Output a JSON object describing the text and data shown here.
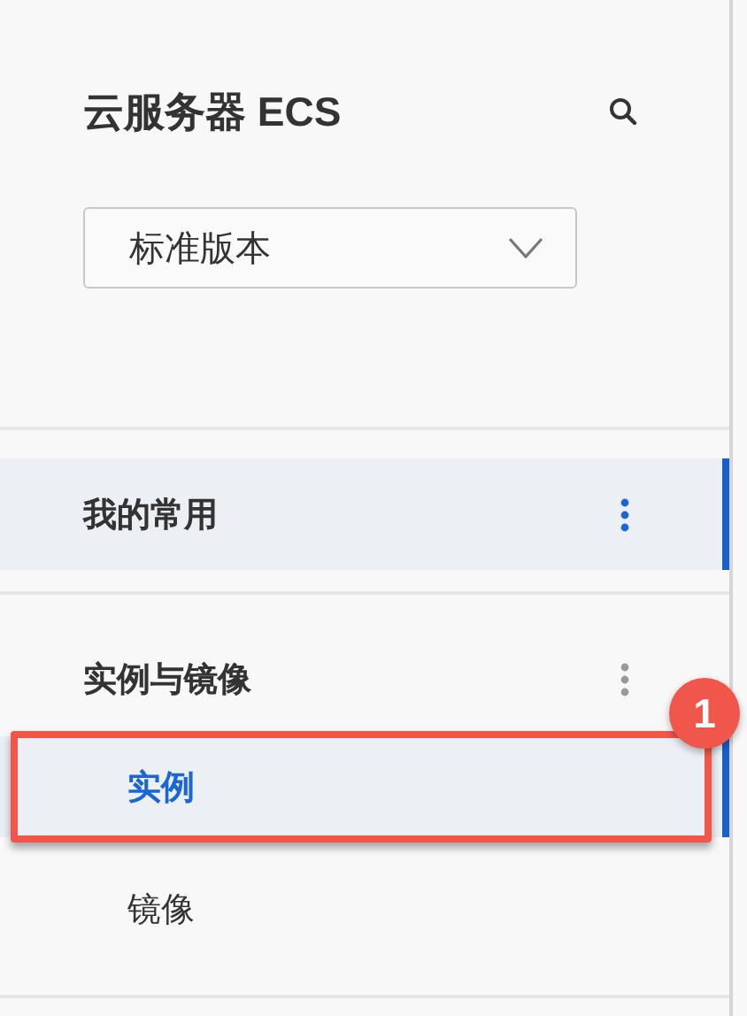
{
  "header": {
    "title": "云服务器 ECS"
  },
  "version_select": {
    "value": "标准版本"
  },
  "groups": [
    {
      "title": "我的常用",
      "selected": true
    },
    {
      "title": "实例与镜像",
      "selected": false,
      "items": [
        {
          "label": "实例",
          "selected": true,
          "callout": "1"
        },
        {
          "label": "镜像",
          "selected": false
        }
      ]
    }
  ]
}
